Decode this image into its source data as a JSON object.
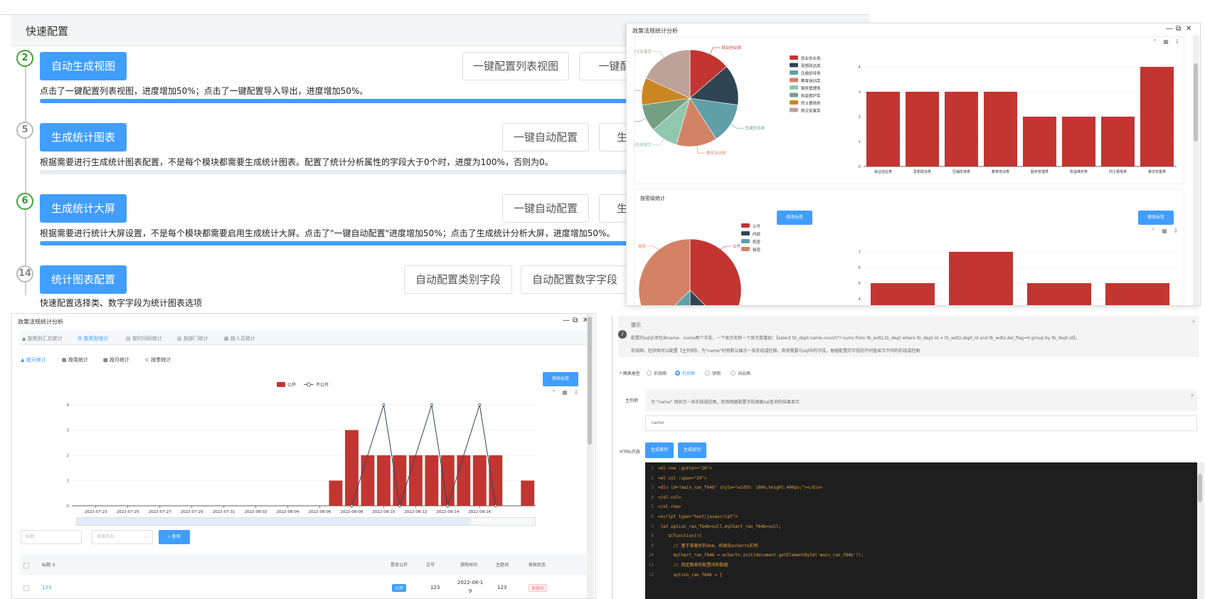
{
  "quick_config": {
    "title": "快速配置",
    "steps": [
      {
        "number": "2",
        "button": "自动生成视图",
        "actions": [
          "一键配置列表视图",
          "一键配"
        ],
        "description": "点击了一键配置列表视图，进度增加50%；点击了一键配置导入导出，进度增加50%。",
        "progress": 1.0,
        "complete": true
      },
      {
        "number": "5",
        "button": "生成统计图表",
        "actions": [
          "一键自动配置",
          "生成"
        ],
        "description": "根据需要进行生成统计图表配置，不是每个模块都需要生成统计图表。配置了统计分析属性的字段大于0个时，进度为100%，否则为0。",
        "progress": 0,
        "complete": false
      },
      {
        "number": "6",
        "button": "生成统计大屏",
        "actions": [
          "一键自动配置",
          "生成"
        ],
        "description": "根据需要进行统计大屏设置，不是每个模块都需要启用生成统计大屏。点击了\"一键自动配置\"进度增加50%；点击了生成统计分析大屏，进度增加50%。",
        "progress": 1.0,
        "complete": true
      },
      {
        "number": "14",
        "button": "统计图表配置",
        "actions": [
          "自动配置类别字段",
          "自动配置数字字段"
        ],
        "description": "快速配置选择类、数字字段为统计图表选项",
        "progress": null,
        "complete": false
      }
    ]
  },
  "top_right_window": {
    "title": "政策法规统计分析",
    "controls": [
      "—",
      "⧉",
      "✕"
    ],
    "section2_title": "按密级统计",
    "edit_label": "修改标签",
    "colors": {
      "red": "#c23531",
      "navy": "#2f4554",
      "teal": "#61a0a8",
      "salmon": "#d48265",
      "mint": "#91c7ae",
      "olive": "#749f83",
      "orange": "#ca8622",
      "taupe": "#bda29a"
    },
    "chart_data": [
      {
        "type": "pie",
        "legend": [
          "就业创业类",
          "思想政治类",
          "压缩优待类",
          "教育培训类",
          "服务管理类",
          "权益维护类",
          "烈士褒扬类",
          "移交安置类"
        ],
        "callout_labels": [
          "就业创业类",
          "压缩优待类",
          "教育培训类",
          "服务管理类",
          "权益维护类",
          "烈士褒扬类",
          "移交安置类"
        ],
        "values": [
          3,
          3,
          3,
          3,
          2,
          2,
          2,
          4
        ]
      },
      {
        "type": "bar",
        "categories": [
          "就业创业类",
          "思想政治类",
          "压缩优待类",
          "教育培训类",
          "服务管理类",
          "权益维护类",
          "烈士褒扬类",
          "移交安置类"
        ],
        "values": [
          3,
          3,
          3,
          3,
          2,
          2,
          2,
          4
        ],
        "ylim": [
          0,
          4
        ],
        "yticks": [
          "0",
          "1",
          "2",
          "3",
          "4"
        ]
      },
      {
        "type": "pie",
        "legend": [
          "公开",
          "内部",
          "机密",
          "秘密"
        ],
        "callout_labels": [
          "公开",
          "秘密"
        ]
      },
      {
        "type": "bar",
        "yticks": [
          "3",
          "4",
          "5",
          "6",
          "7"
        ],
        "values": [
          5,
          7,
          5,
          5
        ],
        "ylim": [
          3,
          7
        ]
      }
    ]
  },
  "bottom_left_window": {
    "title": "政策法规统计分析",
    "controls": [
      "—",
      "⧉",
      "✕"
    ],
    "tabs": [
      "按类别汇总统计",
      "按类型统计",
      "按时间段统计",
      "按部门统计",
      "按人员统计"
    ],
    "active_tab": 1,
    "subtabs": [
      "按天统计",
      "按周统计",
      "按月统计",
      "按季统计"
    ],
    "active_subtab": 0,
    "edit_label": "修改标签",
    "legend": [
      "公开",
      "不公开"
    ],
    "filter": {
      "title_placeholder": "标题",
      "status_placeholder": "审核状态",
      "search_label": "查询"
    },
    "table": {
      "headers": [
        "标题",
        "是否公开",
        "文号",
        "颁布时间",
        "主题词",
        "审核状态"
      ],
      "row": {
        "title": "123",
        "public": "公开",
        "doc_no": "123",
        "date_line1": "2022-08-1",
        "date_line2": "9",
        "keyword": "123",
        "status": "审核中"
      }
    },
    "chart_data": {
      "type": "bar",
      "x_ticks": [
        "2022-07-23",
        "2022-07-25",
        "2022-07-27",
        "2022-07-29",
        "2022-07-31",
        "2022-08-02",
        "2022-08-04",
        "2022-08-06",
        "2022-08-08",
        "2022-08-10",
        "2022-08-12",
        "2022-08-14",
        "2022-08-16"
      ],
      "yticks": [
        "0",
        "1",
        "2",
        "3",
        "4"
      ],
      "ylim": [
        0,
        4
      ],
      "series": [
        {
          "name": "公开",
          "type": "bar",
          "points": [
            {
              "x": "2022-08-07",
              "y": 1
            },
            {
              "x": "2022-08-08",
              "y": 3
            },
            {
              "x": "2022-08-09",
              "y": 2
            },
            {
              "x": "2022-08-10",
              "y": 2
            },
            {
              "x": "2022-08-11",
              "y": 2
            },
            {
              "x": "2022-08-12",
              "y": 2
            },
            {
              "x": "2022-08-13",
              "y": 2
            },
            {
              "x": "2022-08-14",
              "y": 2
            },
            {
              "x": "2022-08-15",
              "y": 2
            },
            {
              "x": "2022-08-16",
              "y": 2
            },
            {
              "x": "2022-08-17",
              "y": 2
            },
            {
              "x": "2022-08-19",
              "y": 1
            }
          ]
        },
        {
          "name": "不公开",
          "type": "line",
          "points": [
            {
              "x": "2022-08-08",
              "y": 0
            },
            {
              "x": "2022-08-10",
              "y": 4
            },
            {
              "x": "2022-08-11",
              "y": 0
            },
            {
              "x": "2022-08-13",
              "y": 4
            },
            {
              "x": "2022-08-14",
              "y": 0
            },
            {
              "x": "2022-08-16",
              "y": 4
            },
            {
              "x": "2022-08-17",
              "y": 0
            }
          ]
        }
      ]
    }
  },
  "bottom_right_window": {
    "tip_title": "提示",
    "tip_line1": "配置的sql必须包含name、nums两个字段，一个显示名称一个显示数量如：【select tb_dept.name,count(*) nums from tb_wdtz,tb_dept where tb_dept.id = tb_wdtz.dept_id and tb_wdtz.del_flag=0 group by tb_dept.id】。",
    "tip_line2": "折线图、柱状图可以配置【主列项】，为\"name\"时则默认展示一条折线或柱图，否则需要与sql中的字段，根据配置的字段的不同值显示不同的折线或柱图",
    "chart_type_label": "* 图表类型",
    "chart_types": [
      "折线图",
      "柱状图",
      "饼图",
      "词云图"
    ],
    "selected_type": 1,
    "main_column_label": "主列项",
    "main_column_hint": "为 \"name\" 则显示一条折线或柱图，否则根据配置字段根据sql查询的结果显示",
    "main_column_value": "name",
    "html_label": "HTML内容",
    "gen_single": "生成单列",
    "gen_double": "生成双列",
    "code_lines": [
      "<el-row :gutter=\"20\">",
      "<el-col :span=\"24\">",
      "<div id=\"main_ran_f64b\" style=\"width: 100%;height:400px;\"></div>",
      "</el-col>",
      "</el-row>",
      "<script type=\"text/javascript\">",
      " let option_ran_f64b=null,myChart_ran_f64b=null;",
      "    $(function(){",
      "      // 基于准备好的dom，初始化echarts实例",
      "      myChart_ran_f64b = echarts.init(document.getElementById('main_ran_f64b'));",
      "      // 指定图表的配置项和数据",
      "      option_ran_f64b = {"
    ]
  }
}
